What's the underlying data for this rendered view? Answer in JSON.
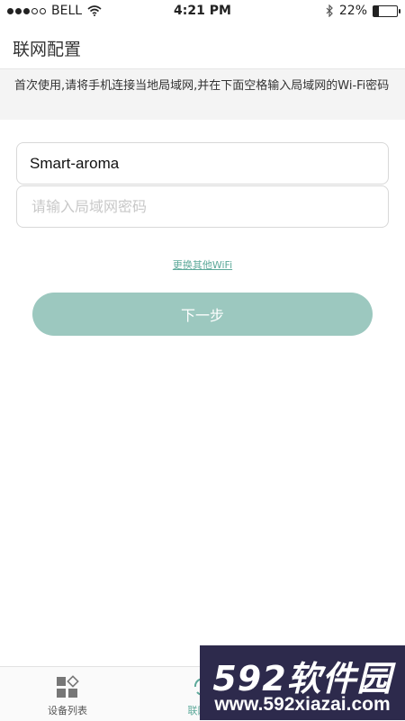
{
  "status_bar": {
    "carrier": "BELL",
    "time": "4:21 PM",
    "battery": "22%",
    "battery_level": 0.22,
    "signal_dots": [
      true,
      true,
      true,
      false,
      false
    ]
  },
  "header": {
    "title": "联网配置"
  },
  "instruction": "首次使用,请将手机连接当地局域网,并在下面空格输入局域网的Wi-Fi密码",
  "form": {
    "ssid": "Smart-aroma",
    "password_placeholder": "请输入局域网密码",
    "password_value": ""
  },
  "change_wifi_link": "更换其他WiFi",
  "next_button": "下一步",
  "tabs": [
    {
      "label": "设备列表",
      "icon": "device-grid-icon"
    },
    {
      "label": "联网配",
      "icon": "refresh-icon"
    }
  ],
  "watermark": {
    "line1": "592软件园",
    "line2": "www.592xiazai.com"
  },
  "colors": {
    "accent": "#9cc8bf",
    "link": "#5da99a"
  }
}
